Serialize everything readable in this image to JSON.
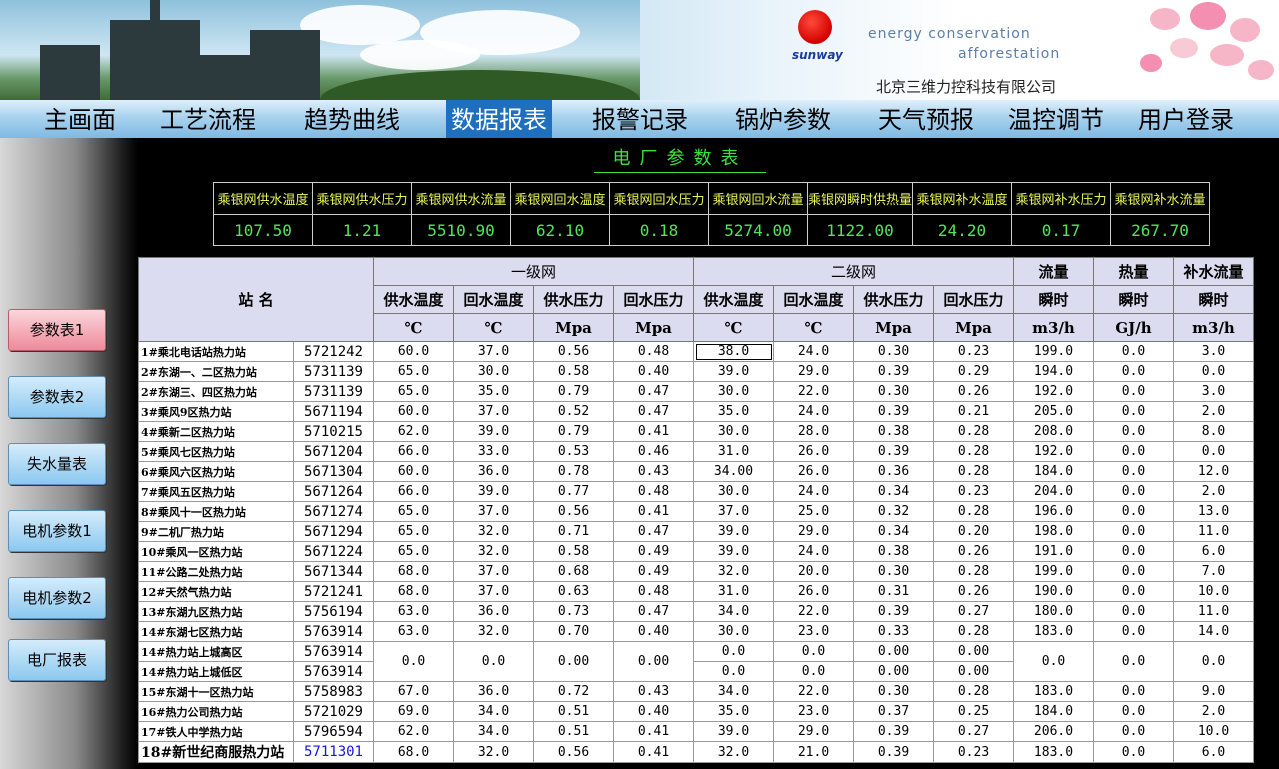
{
  "brand": {
    "logo_text": "sunway",
    "slogan_line1": "energy conservation",
    "slogan_line2": "afforestation",
    "company": "北京三维力控科技有限公司"
  },
  "nav": {
    "items": [
      "主画面",
      "工艺流程",
      "趋势曲线",
      "数据报表",
      "报警记录",
      "锅炉参数",
      "天气预报",
      "温控调节",
      "用户登录"
    ],
    "active": "数据报表"
  },
  "sidebar": {
    "buttons": [
      "参数表1",
      "参数表2",
      "失水量表",
      "电机参数1",
      "电机参数2",
      "电厂报表"
    ],
    "active": "参数表1"
  },
  "page_title": "电厂参数表",
  "summary": {
    "headers": [
      "乘银网供水温度",
      "乘银网供水压力",
      "乘银网供水流量",
      "乘银网回水温度",
      "乘银网回水压力",
      "乘银网回水流量",
      "乘银网瞬时供热量",
      "乘银网补水温度",
      "乘银网补水压力",
      "乘银网补水流量"
    ],
    "values": [
      "107.50",
      "1.21",
      "5510.90",
      "62.10",
      "0.18",
      "5274.00",
      "1122.00",
      "24.20",
      "0.17",
      "267.70"
    ]
  },
  "table": {
    "header_station": "站  名",
    "group_primary": "一级网",
    "group_secondary": "二级网",
    "col_flow": "流量",
    "col_heat": "热量",
    "col_makeup": "补水流量",
    "sub_headers": [
      "供水温度",
      "回水温度",
      "供水压力",
      "回水压力",
      "供水温度",
      "回水温度",
      "供水压力",
      "回水压力",
      "瞬时",
      "瞬时",
      "瞬时"
    ],
    "units": [
      "℃",
      "℃",
      "Mpa",
      "Mpa",
      "℃",
      "℃",
      "Mpa",
      "Mpa",
      "m3/h",
      "GJ/h",
      "m3/h"
    ],
    "rows": [
      [
        "1#乘北电话站热力站",
        "5721242",
        "60.0",
        "37.0",
        "0.56",
        "0.48",
        "38.0",
        "24.0",
        "0.30",
        "0.23",
        "199.0",
        "0.0",
        "3.0"
      ],
      [
        "2#东湖一、二区热力站",
        "5731139",
        "65.0",
        "30.0",
        "0.58",
        "0.40",
        "39.0",
        "29.0",
        "0.39",
        "0.29",
        "194.0",
        "0.0",
        "0.0"
      ],
      [
        "2#东湖三、四区热力站",
        "5731139",
        "65.0",
        "35.0",
        "0.79",
        "0.47",
        "30.0",
        "22.0",
        "0.30",
        "0.26",
        "192.0",
        "0.0",
        "3.0"
      ],
      [
        "3#乘风9区热力站",
        "5671194",
        "60.0",
        "37.0",
        "0.52",
        "0.47",
        "35.0",
        "24.0",
        "0.39",
        "0.21",
        "205.0",
        "0.0",
        "2.0"
      ],
      [
        "4#乘新二区热力站",
        "5710215",
        "62.0",
        "39.0",
        "0.79",
        "0.41",
        "30.0",
        "28.0",
        "0.38",
        "0.28",
        "208.0",
        "0.0",
        "8.0"
      ],
      [
        "5#乘风七区热力站",
        "5671204",
        "66.0",
        "33.0",
        "0.53",
        "0.46",
        "31.0",
        "26.0",
        "0.39",
        "0.28",
        "192.0",
        "0.0",
        "0.0"
      ],
      [
        "6#乘风六区热力站",
        "5671304",
        "60.0",
        "36.0",
        "0.78",
        "0.43",
        "34.00",
        "26.0",
        "0.36",
        "0.28",
        "184.0",
        "0.0",
        "12.0"
      ],
      [
        "7#乘风五区热力站",
        "5671264",
        "66.0",
        "39.0",
        "0.77",
        "0.48",
        "30.0",
        "24.0",
        "0.34",
        "0.23",
        "204.0",
        "0.0",
        "2.0"
      ],
      [
        "8#乘风十一区热力站",
        "5671274",
        "65.0",
        "37.0",
        "0.56",
        "0.41",
        "37.0",
        "25.0",
        "0.32",
        "0.28",
        "196.0",
        "0.0",
        "13.0"
      ],
      [
        "9#二机厂热力站",
        "5671294",
        "65.0",
        "32.0",
        "0.71",
        "0.47",
        "39.0",
        "29.0",
        "0.34",
        "0.20",
        "198.0",
        "0.0",
        "11.0"
      ],
      [
        "10#乘风一区热力站",
        "5671224",
        "65.0",
        "32.0",
        "0.58",
        "0.49",
        "39.0",
        "24.0",
        "0.38",
        "0.26",
        "191.0",
        "0.0",
        "6.0"
      ],
      [
        "11#公路二处热力站",
        "5671344",
        "68.0",
        "37.0",
        "0.68",
        "0.49",
        "32.0",
        "20.0",
        "0.30",
        "0.28",
        "199.0",
        "0.0",
        "7.0"
      ],
      [
        "12#天然气热力站",
        "5721241",
        "68.0",
        "37.0",
        "0.63",
        "0.48",
        "31.0",
        "26.0",
        "0.31",
        "0.26",
        "190.0",
        "0.0",
        "10.0"
      ],
      [
        "13#东湖九区热力站",
        "5756194",
        "63.0",
        "36.0",
        "0.73",
        "0.47",
        "34.0",
        "22.0",
        "0.39",
        "0.27",
        "180.0",
        "0.0",
        "11.0"
      ],
      [
        "14#东湖七区热力站",
        "5763914",
        "63.0",
        "32.0",
        "0.70",
        "0.40",
        "30.0",
        "23.0",
        "0.33",
        "0.28",
        "183.0",
        "0.0",
        "14.0"
      ]
    ],
    "split_row": {
      "name_a": "14#热力站上城高区",
      "code_a": "5763914",
      "name_b": "14#热力站上城低区",
      "code_b": "5763914",
      "p1": "0.0",
      "p2": "0.0",
      "p3": "0.00",
      "p4": "0.00",
      "sa": [
        "0.0",
        "0.0",
        "0.00",
        "0.00"
      ],
      "sb": [
        "0.0",
        "0.0",
        "0.00",
        "0.00"
      ],
      "flow": "0.0",
      "heat": "0.0",
      "makeup": "0.0"
    },
    "rows_after": [
      [
        "15#东湖十一区热力站",
        "5758983",
        "67.0",
        "36.0",
        "0.72",
        "0.43",
        "34.0",
        "22.0",
        "0.30",
        "0.28",
        "183.0",
        "0.0",
        "9.0"
      ],
      [
        "16#热力公司热力站",
        "5721029",
        "69.0",
        "34.0",
        "0.51",
        "0.40",
        "35.0",
        "23.0",
        "0.37",
        "0.25",
        "184.0",
        "0.0",
        "2.0"
      ],
      [
        "17#铁人中学热力站",
        "5796594",
        "62.0",
        "34.0",
        "0.51",
        "0.41",
        "39.0",
        "29.0",
        "0.39",
        "0.27",
        "206.0",
        "0.0",
        "10.0"
      ],
      [
        "18#新世纪商服热力站",
        "5711301",
        "68.0",
        "32.0",
        "0.56",
        "0.41",
        "32.0",
        "21.0",
        "0.39",
        "0.23",
        "183.0",
        "0.0",
        "6.0"
      ]
    ]
  }
}
